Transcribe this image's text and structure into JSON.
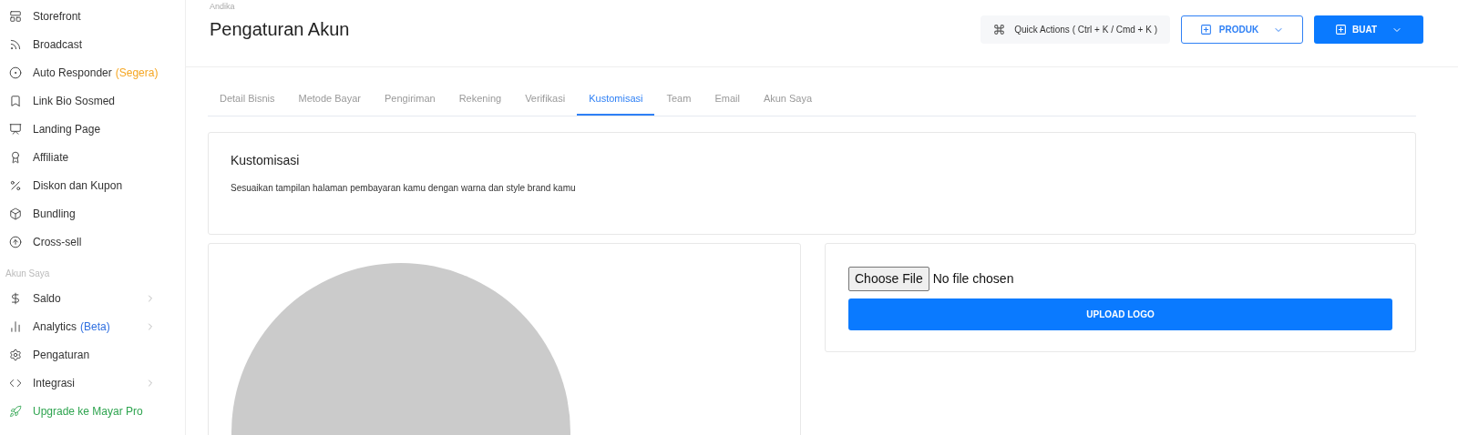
{
  "sidebar": {
    "items": [
      {
        "label": "Storefront"
      },
      {
        "label": "Broadcast"
      },
      {
        "label": "Auto Responder",
        "tag": {
          "text": "(Segera)",
          "color": "#f5a623"
        }
      },
      {
        "label": "Link Bio Sosmed"
      },
      {
        "label": "Landing Page"
      },
      {
        "label": "Affiliate"
      },
      {
        "label": "Diskon dan Kupon"
      },
      {
        "label": "Bundling"
      },
      {
        "label": "Cross-sell"
      }
    ],
    "section_title": "Akun Saya",
    "account_items": [
      {
        "label": "Saldo",
        "has_submenu": true
      },
      {
        "label": "Analytics",
        "tag": {
          "text": "(Beta)",
          "color": "#2f6fe0"
        },
        "has_submenu": true
      },
      {
        "label": "Pengaturan"
      },
      {
        "label": "Integrasi",
        "has_submenu": true
      },
      {
        "label": "Upgrade ke Mayar Pro",
        "kind": "upgrade"
      }
    ]
  },
  "header": {
    "breadcrumb": "Andika",
    "title": "Pengaturan Akun",
    "quick_actions": "Quick Actions ( Ctrl + K / Cmd + K )",
    "product_button": "PRODUK",
    "create_button": "BUAT"
  },
  "tabs": [
    {
      "label": "Detail Bisnis",
      "selected": false
    },
    {
      "label": "Metode Bayar",
      "selected": false
    },
    {
      "label": "Pengiriman",
      "selected": false
    },
    {
      "label": "Rekening",
      "selected": false
    },
    {
      "label": "Verifikasi",
      "selected": false
    },
    {
      "label": "Kustomisasi",
      "selected": true
    },
    {
      "label": "Team",
      "selected": false
    },
    {
      "label": "Email",
      "selected": false
    },
    {
      "label": "Akun Saya",
      "selected": false
    }
  ],
  "section": {
    "title": "Kustomisasi",
    "description": "Sesuaikan tampilan halaman pembayaran kamu dengan warna dan style brand kamu"
  },
  "upload": {
    "choose_file": "Choose File",
    "file_status": "No file chosen",
    "button": "UPLOAD LOGO"
  }
}
